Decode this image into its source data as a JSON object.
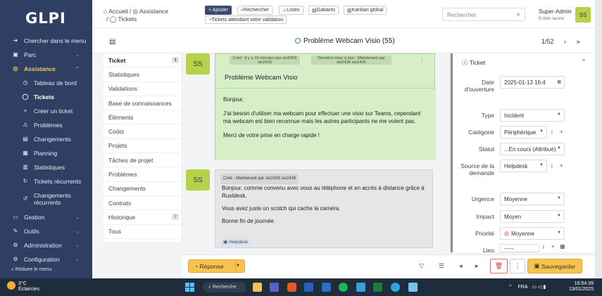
{
  "sidebar": {
    "logo": "GLPI",
    "items": [
      {
        "label": "Chercher dans le menu",
        "icon": "arrow-icon"
      },
      {
        "label": "Parc",
        "icon": "box-icon"
      },
      {
        "label": "Assistance",
        "icon": "lifebuoy-icon"
      },
      {
        "label": "Tableau de bord",
        "icon": "dashboard-icon"
      },
      {
        "label": "Tickets",
        "icon": "ticket-icon"
      },
      {
        "label": "Créer un ticket",
        "icon": "plus-icon"
      },
      {
        "label": "Problèmes",
        "icon": "warning-icon"
      },
      {
        "label": "Changements",
        "icon": "clipboard-icon"
      },
      {
        "label": "Planning",
        "icon": "calendar-icon"
      },
      {
        "label": "Statistiques",
        "icon": "stats-icon"
      },
      {
        "label": "Tickets récurrents",
        "icon": "recurrent-icon"
      },
      {
        "label": "Changements récurrents",
        "icon": "recurrent-changes-icon"
      },
      {
        "label": "Gestion",
        "icon": "wallet-icon"
      },
      {
        "label": "Outils",
        "icon": "tools-icon"
      },
      {
        "label": "Administration",
        "icon": "admin-icon"
      },
      {
        "label": "Configuration",
        "icon": "gear-icon"
      }
    ],
    "reduce_label": "Réduire le menu"
  },
  "topbar": {
    "breadcrumb_home": "Accueil",
    "breadcrumb_assistance": "Assistance",
    "breadcrumb_tickets": "Tickets",
    "add_label": "+ Ajouter",
    "search_label": "Rechercher",
    "lists_label": "Listes",
    "templates_label": "Gabarits",
    "kanban_label": "Kanban global",
    "waiting_label": "Tickets attendant votre validation",
    "search_placeholder": "Rechercher",
    "user_name": "Super-Admin",
    "user_entity": "Entité racine",
    "user_initials": "SS"
  },
  "ticket": {
    "title": "Problème Webcam Visio (55)",
    "pager": "1/52"
  },
  "tabs": [
    {
      "label": "Ticket",
      "count": "1"
    },
    {
      "label": "Statistiques",
      "count": ""
    },
    {
      "label": "Validations",
      "count": ""
    },
    {
      "label": "Base de connaissances",
      "count": ""
    },
    {
      "label": "Éléments",
      "count": ""
    },
    {
      "label": "Coûts",
      "count": ""
    },
    {
      "label": "Projets",
      "count": ""
    },
    {
      "label": "Tâches de projet",
      "count": ""
    },
    {
      "label": "Problèmes",
      "count": ""
    },
    {
      "label": "Changements",
      "count": ""
    },
    {
      "label": "Contrats",
      "count": ""
    },
    {
      "label": "Historique",
      "count": "7"
    },
    {
      "label": "Tous",
      "count": ""
    }
  ],
  "timeline": {
    "avatar": "SS",
    "created_meta": "Créé : il y a 10 minutes par sio2426 sio2426",
    "updated_meta": "Dernière mise à jour : Maintenant par sio2426 sio2426",
    "title": "Problème Webcam Visio",
    "body": [
      "Bonjour,",
      "J'ai besoin d'utiliser ma webcam pour effectuer une visio sur Teams, cependant ma webcam est bien reconnue mais les autres participants ne me voient pas.",
      "Merci de votre prise en charge rapide !"
    ],
    "followup_meta": "Créé : Maintenant par sio2426 sio2426",
    "followup_body": [
      "Bonjour, comme convenu avec vous au téléphone et en accès à distance grâce à Rustdesk.",
      "Vous avez juste un scotch qui cache la caméra.",
      "Bonne fin de journée."
    ],
    "followup_tag": "Helpdesk"
  },
  "panel": {
    "header": "Ticket",
    "fields": {
      "date_label": "Date d'ouverture",
      "date_value": "2025-01-13 16:4",
      "type_label": "Type",
      "type_value": "Incident",
      "category_label": "Catégorie",
      "category_value": "Périphérique",
      "status_label": "Statut",
      "status_value": "...En cours (Attribué)",
      "source_label": "Source de la demande",
      "source_value": "Helpdesk",
      "urgency_label": "Urgence",
      "urgency_value": "Moyenne",
      "impact_label": "Impact",
      "impact_value": "Moyen",
      "priority_label": "Priorité",
      "priority_value": "Moyenne",
      "location_label": "Lieu",
      "location_value": "-----"
    }
  },
  "actions": {
    "reply_label": "Réponse",
    "save_label": "Sauvegarder"
  },
  "taskbar": {
    "temp": "3°C",
    "weather": "Éclaircies",
    "search": "Recherche",
    "lang": "FRA",
    "time": "16:54:39",
    "date": "13/01/2025"
  }
}
